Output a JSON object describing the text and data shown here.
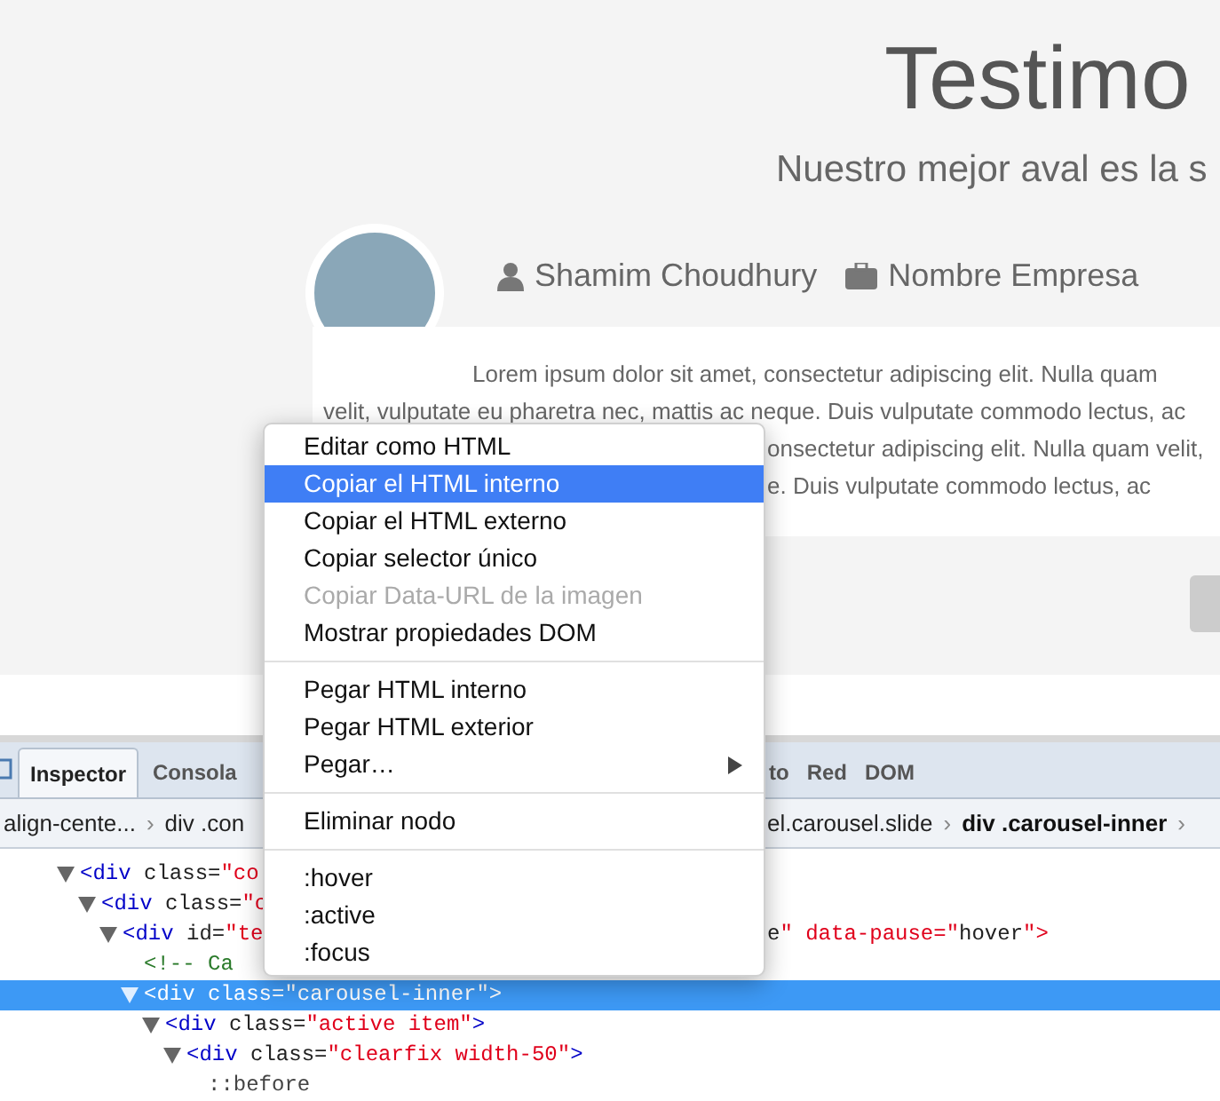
{
  "page": {
    "title": "Testimo",
    "subtitle": "Nuestro mejor aval es la s",
    "author": "Shamim Choudhury",
    "company": "Nombre Empresa",
    "paragraph_lines": [
      "Lorem ipsum dolor sit amet, consectetur adipiscing elit. Nulla quam",
      "velit, vulputate eu pharetra nec, mattis ac neque. Duis vulputate commodo lectus, ac"
    ],
    "paragraph_fragments": [
      "onsectetur adipiscing elit. Nulla quam velit,",
      "e. Duis vulputate commodo lectus, ac"
    ]
  },
  "devtools": {
    "tabs_left": [
      {
        "label": "Inspector",
        "selected": true
      },
      {
        "label": "Consola",
        "selected": false
      }
    ],
    "tabs_right": [
      {
        "label": "to",
        "selected": false
      },
      {
        "label": "Red",
        "selected": false
      },
      {
        "label": "DOM",
        "selected": false
      }
    ],
    "breadcrumbs_left": [
      {
        "label": "align-cente...",
        "selected": false
      },
      {
        "label": "div .con",
        "selected": false
      }
    ],
    "breadcrumbs_right": [
      {
        "label": "el.carousel.slide",
        "selected": false
      },
      {
        "label": "div .carousel-inner",
        "selected": true
      }
    ],
    "separator": "›",
    "nodes": [
      {
        "kind": "element",
        "left": "<div class=\"co",
        "expanded": true,
        "selected": false,
        "children": [
          {
            "kind": "element",
            "left": "<div class=\"c",
            "expanded": true,
            "selected": false,
            "children": [
              {
                "kind": "element",
                "left": "<div id=\"te",
                "right": "e\" data-pause=\"hover\">",
                "expanded": true,
                "selected": false,
                "children": [
                  {
                    "kind": "comment",
                    "left": "<!--  Ca",
                    "selected": false
                  },
                  {
                    "kind": "element",
                    "left": "<div class=\"carousel-inner\">",
                    "expanded": true,
                    "selected": true,
                    "children": [
                      {
                        "kind": "element",
                        "left": "<div class=\"active item\">",
                        "expanded": true,
                        "selected": false,
                        "children": [
                          {
                            "kind": "element",
                            "left": "<div class=\"clearfix width-50\">",
                            "expanded": true,
                            "selected": false,
                            "children": [
                              {
                                "kind": "pseudo",
                                "left": "::before",
                                "selected": false
                              }
                            ]
                          }
                        ]
                      }
                    ]
                  }
                ]
              }
            ]
          }
        ]
      }
    ]
  },
  "context_menu": [
    {
      "kind": "item",
      "label": "Editar como HTML",
      "selected": false,
      "disabled": false,
      "submenu": false
    },
    {
      "kind": "item",
      "label": "Copiar el HTML interno",
      "selected": true,
      "disabled": false,
      "submenu": false
    },
    {
      "kind": "item",
      "label": "Copiar el HTML externo",
      "selected": false,
      "disabled": false,
      "submenu": false
    },
    {
      "kind": "item",
      "label": "Copiar selector único",
      "selected": false,
      "disabled": false,
      "submenu": false
    },
    {
      "kind": "item",
      "label": "Copiar Data-URL de la imagen",
      "selected": false,
      "disabled": true,
      "submenu": false
    },
    {
      "kind": "item",
      "label": "Mostrar propiedades DOM",
      "selected": false,
      "disabled": false,
      "submenu": false
    },
    {
      "kind": "separator"
    },
    {
      "kind": "item",
      "label": "Pegar HTML interno",
      "selected": false,
      "disabled": false,
      "submenu": false
    },
    {
      "kind": "item",
      "label": "Pegar HTML exterior",
      "selected": false,
      "disabled": false,
      "submenu": false
    },
    {
      "kind": "item",
      "label": "Pegar…",
      "selected": false,
      "disabled": false,
      "submenu": true
    },
    {
      "kind": "separator"
    },
    {
      "kind": "item",
      "label": "Eliminar nodo",
      "selected": false,
      "disabled": false,
      "submenu": false
    },
    {
      "kind": "separator"
    },
    {
      "kind": "item",
      "label": ":hover",
      "selected": false,
      "disabled": false,
      "submenu": false
    },
    {
      "kind": "item",
      "label": ":active",
      "selected": false,
      "disabled": false,
      "submenu": false
    },
    {
      "kind": "item",
      "label": ":focus",
      "selected": false,
      "disabled": false,
      "submenu": false
    }
  ]
}
